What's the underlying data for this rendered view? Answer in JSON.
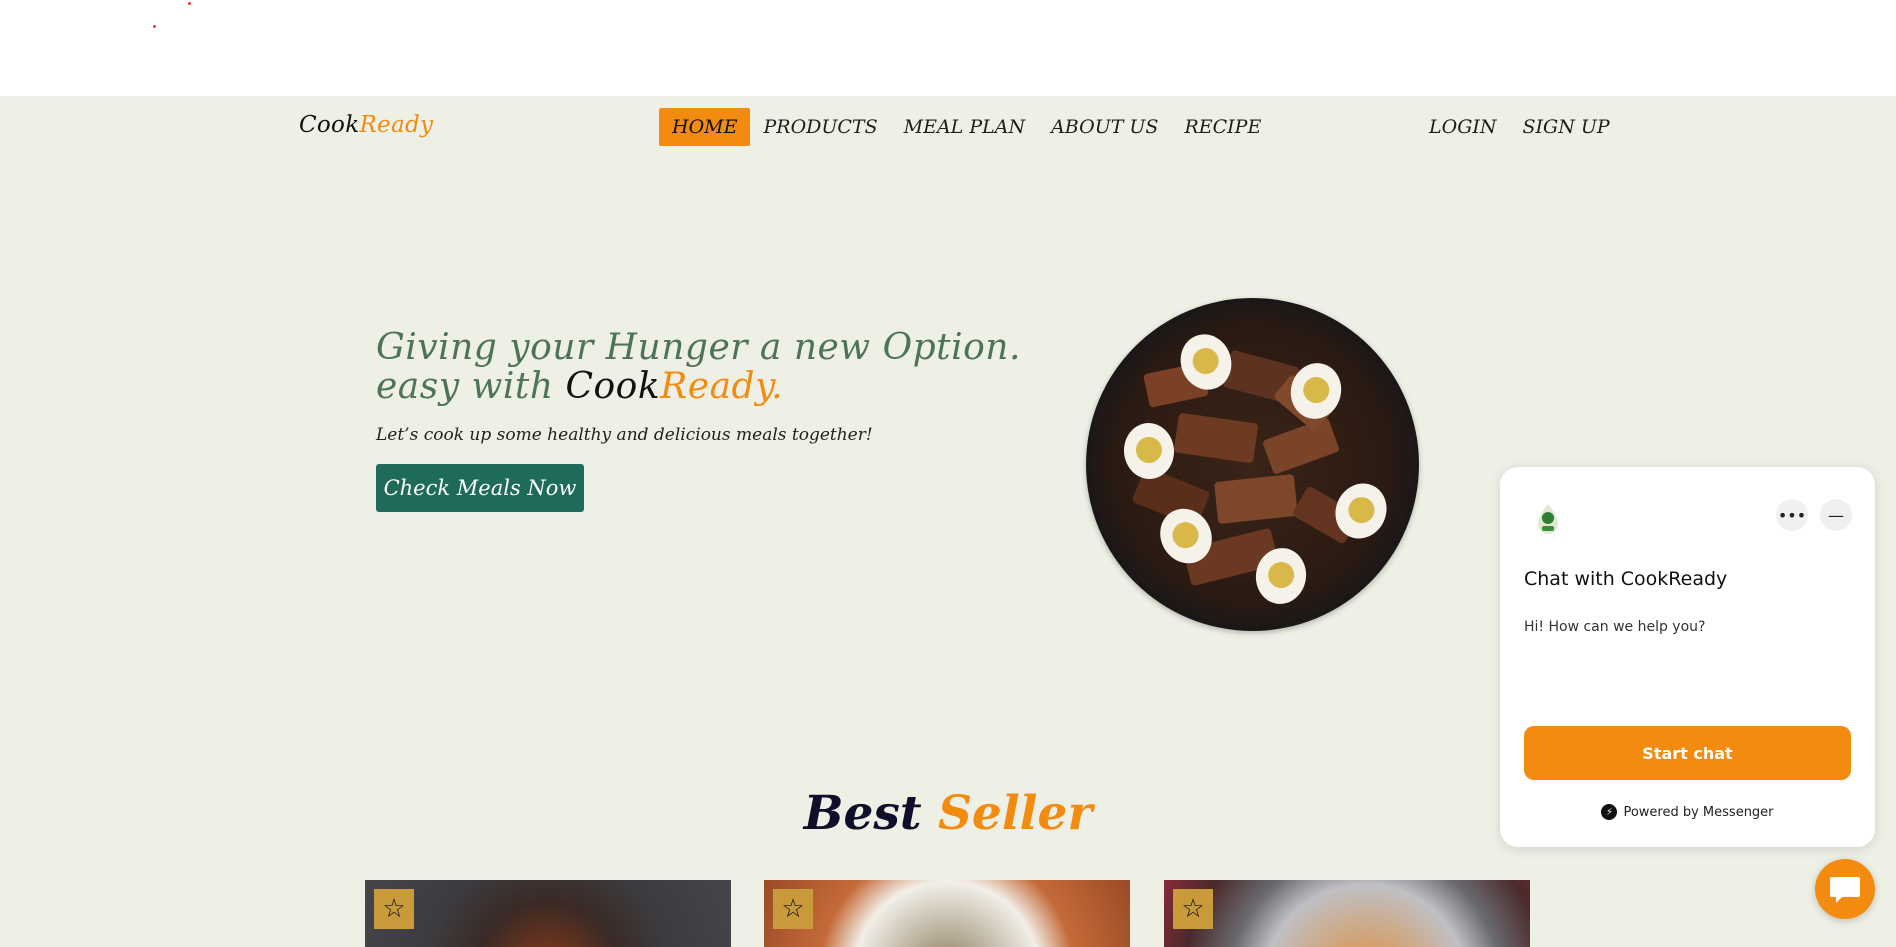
{
  "brand": {
    "part1": "Cook",
    "part2": "Ready"
  },
  "nav": {
    "items": [
      {
        "label": "HOME",
        "active": true
      },
      {
        "label": "PRODUCTS"
      },
      {
        "label": "MEAL PLAN"
      },
      {
        "label": "ABOUT US"
      },
      {
        "label": "RECIPE"
      }
    ],
    "login": "LOGIN",
    "signup": "SIGN UP"
  },
  "hero": {
    "line1": "Giving your Hunger a new Option.",
    "line2_prefix": "easy with ",
    "line2_cook": "Cook",
    "line2_ready": "Ready",
    "line2_suffix": ".",
    "subtitle": "Let’s cook up some healthy and delicious meals together!",
    "cta": "Check Meals Now"
  },
  "best_seller": {
    "word1": "Best",
    "word2": "Seller"
  },
  "products": [
    {
      "badge_icon": "star-icon"
    },
    {
      "badge_icon": "star-icon"
    },
    {
      "badge_icon": "star-icon"
    }
  ],
  "chat": {
    "title": "Chat with CookReady",
    "message": "Hi! How can we help you?",
    "start": "Start chat",
    "powered": "Powered by Messenger",
    "more_icon": "more-icon",
    "minimize_icon": "minimize-icon"
  },
  "colors": {
    "accent": "#f28b10",
    "background": "#eef0e5",
    "cta": "#1f6b59",
    "heading_green": "#4d7457"
  }
}
